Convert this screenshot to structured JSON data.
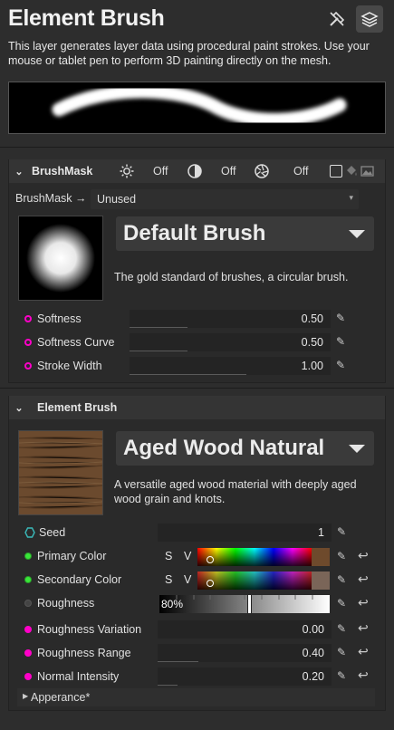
{
  "header": {
    "title": "Element Brush",
    "description": "This layer generates layer data using procedural paint strokes. Use your mouse or tablet pen to perform 3D painting directly on the mesh."
  },
  "brushmask": {
    "title": "BrushMask",
    "toggles": [
      {
        "icon": "sun-icon",
        "state": "Off"
      },
      {
        "icon": "contrast-icon",
        "state": "Off"
      },
      {
        "icon": "aperture-icon",
        "state": "Off"
      }
    ],
    "source_label": "BrushMask →",
    "source_value": "Unused",
    "brush_name": "Default Brush",
    "brush_desc": "The gold standard of brushes, a circular brush.",
    "params": [
      {
        "label": "Softness",
        "value": "0.50",
        "fraction": 0.5
      },
      {
        "label": "Softness Curve",
        "value": "0.50",
        "fraction": 0.5
      },
      {
        "label": "Stroke Width",
        "value": "1.00",
        "fraction": 1.0
      }
    ]
  },
  "element": {
    "title": "Element Brush",
    "material_name": "Aged Wood Natural",
    "material_desc": "A versatile aged wood material with deeply aged wood grain and knots.",
    "seed_label": "Seed",
    "seed_value": "1",
    "primary_label": "Primary Color",
    "primary_color": "#6e4a2c",
    "secondary_label": "Secondary Color",
    "secondary_color": "#7a6558",
    "sv_s": "S",
    "sv_v": "V",
    "roughness_label": "Roughness",
    "roughness_value": "80%",
    "roughness_fraction": 0.8,
    "params": [
      {
        "label": "Roughness Variation",
        "value": "0.00",
        "fraction": 0.0
      },
      {
        "label": "Roughness Range",
        "value": "0.40",
        "fraction": 0.4
      },
      {
        "label": "Normal Intensity",
        "value": "0.20",
        "fraction": 0.2
      }
    ],
    "appearance_label": "Apperance*"
  },
  "colors": {
    "magenta": "#ff00c8",
    "green": "#39e639",
    "cyan": "#3ab9b9"
  }
}
